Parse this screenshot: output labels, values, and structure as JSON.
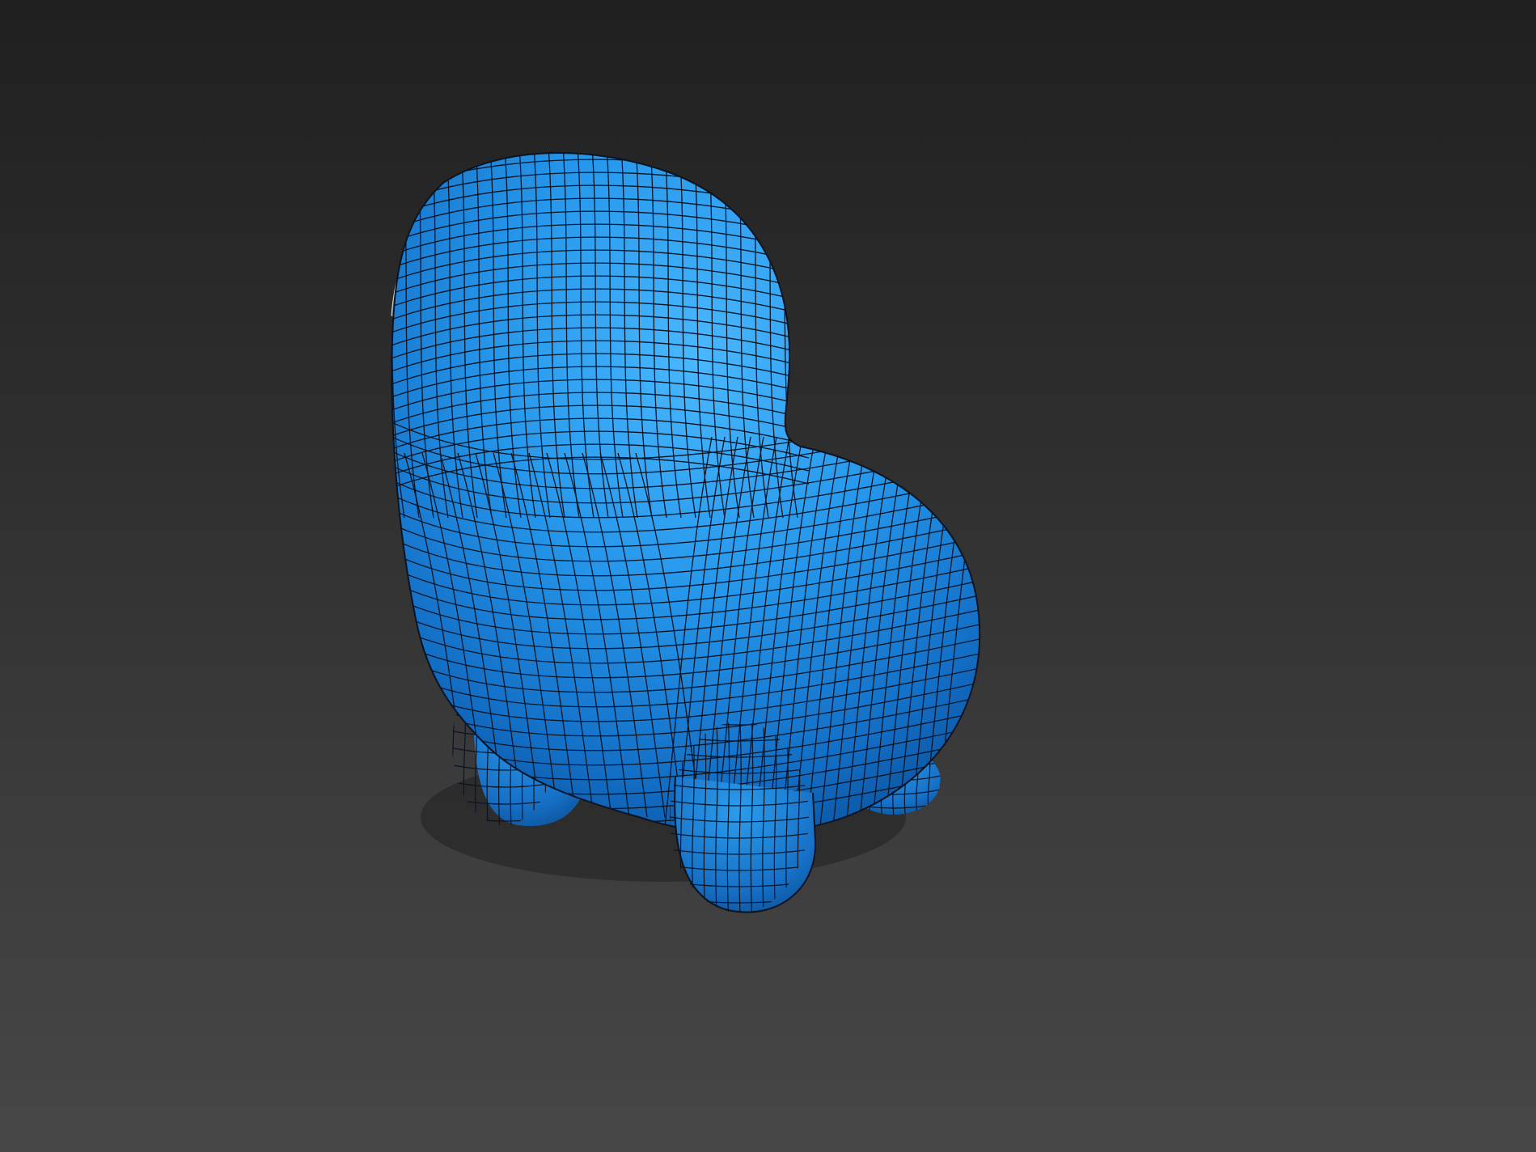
{
  "viewport": {
    "background_top": "#202020",
    "background_bottom": "#474747"
  },
  "model": {
    "object": "crewmate-body-mesh",
    "display_mode": "shaded-with-edged-faces",
    "surface_color": "#1e8fe6",
    "highlight_color": "#46b6ff",
    "shadow_color": "#0a4f9a",
    "wireframe_color": "#0a1422",
    "backpack_edge_color": "#c9c9c9"
  }
}
